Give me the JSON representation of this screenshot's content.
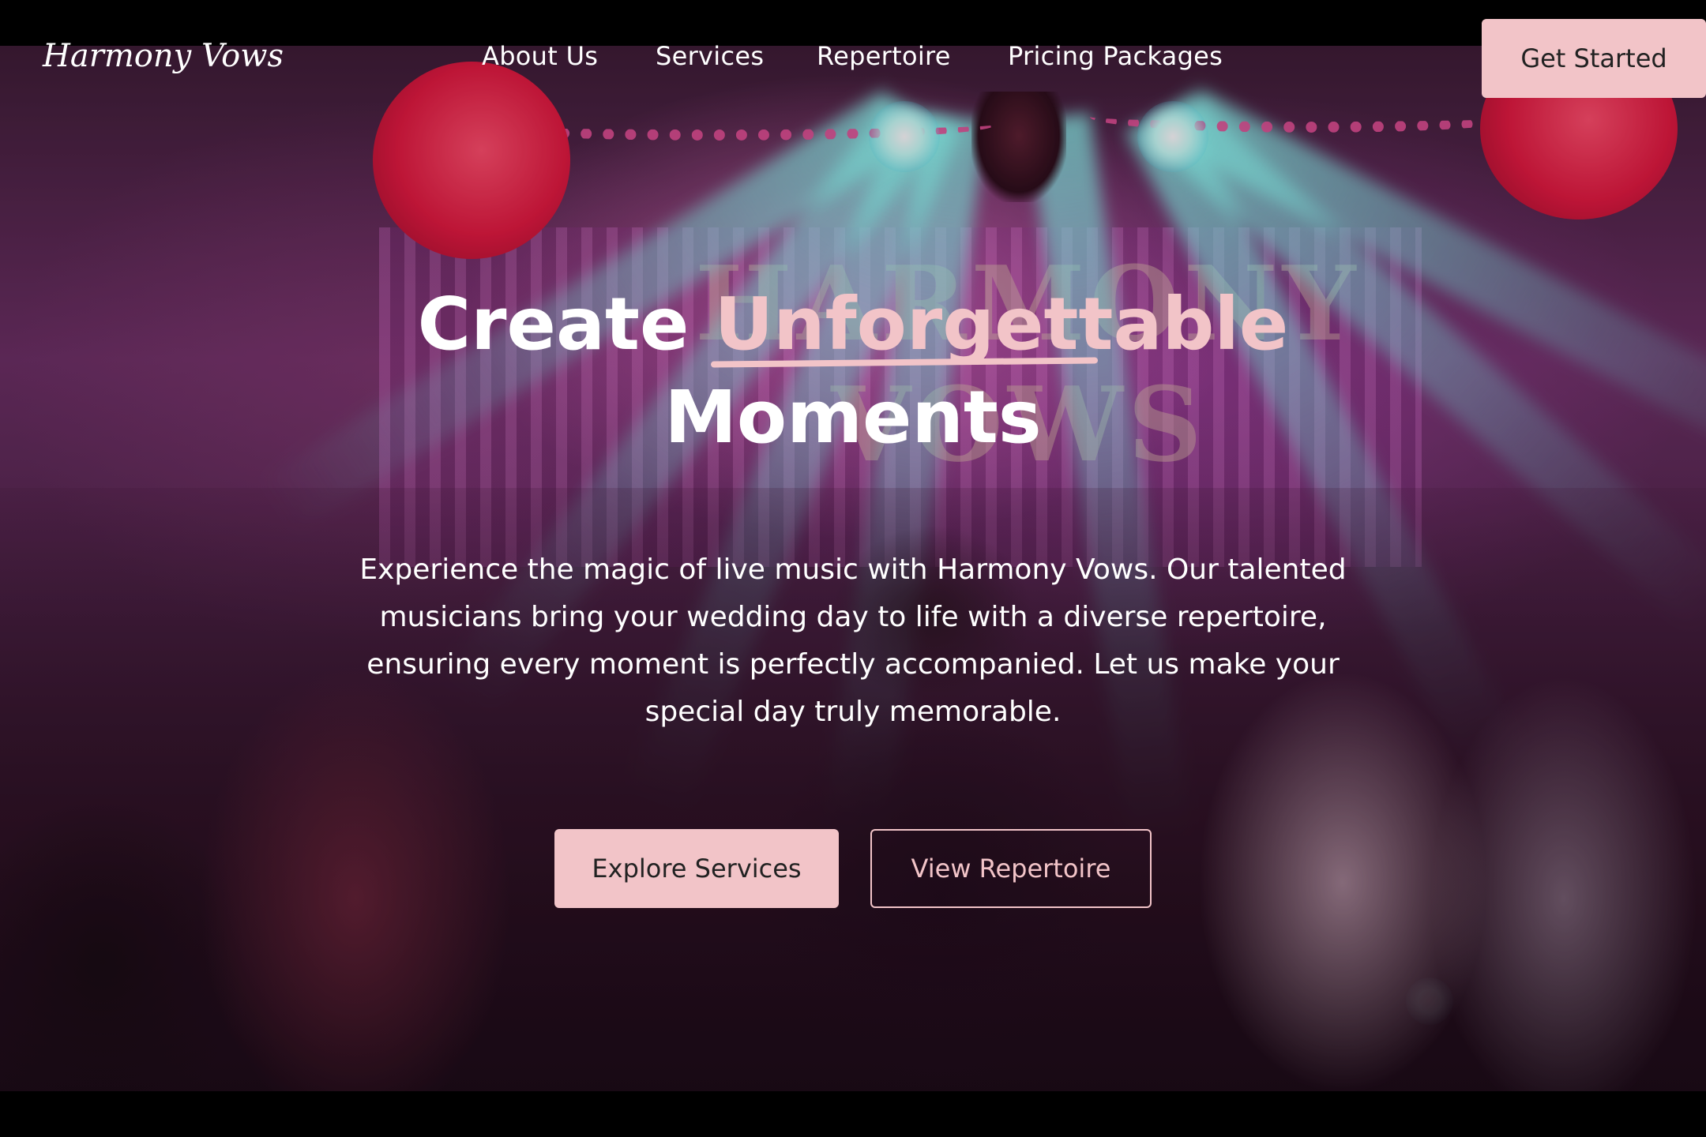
{
  "brand": {
    "logo": "Harmony Vows"
  },
  "nav": {
    "links": [
      "About Us",
      "Services",
      "Repertoire",
      "Pricing Packages"
    ],
    "cta": "Get Started"
  },
  "hero": {
    "headline_pre": "Create",
    "headline_accent": "Unforgettable",
    "headline_post": "Moments",
    "subtext": "Experience the magic of live music with Harmony Vows. Our talented musicians bring your wedding day to life with a diverse repertoire, ensuring every moment is perfectly accompanied. Let us make your special day truly memorable.",
    "primary_button": "Explore Services",
    "secondary_button": "View Repertoire",
    "background_sign_text": "HARMONY VOWS"
  },
  "colors": {
    "accent": "#f2c4c8",
    "text": "#ffffff",
    "button_text": "#222222",
    "band": "#000000"
  }
}
